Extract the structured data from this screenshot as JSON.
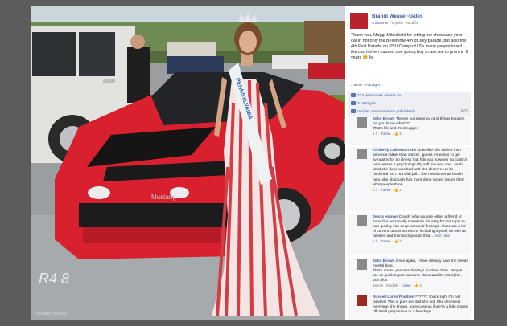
{
  "photo": {
    "credit": "© Image courtesy",
    "plate_text": "R4 8"
  },
  "close": "×",
  "post": {
    "author": "Brandi Weaver-Gates",
    "subscribe": "S'abonner",
    "date": "8 juillet",
    "edited": "Modifié",
    "text": "Thank you, Maggi Mitsubishi for letting me showcase your car in not only the Bellefonte 4th of July parade, but also the 4th Fest Parade on PSU Campus!! So many people loved the car, it even caused one young boy to ask me to prom in 8 years 😊 lol",
    "like": "J'aime",
    "share": "Partager"
  },
  "likes_bar": {
    "text": "213 personnes aiment ça."
  },
  "shares_bar": {
    "text": "3 partages"
  },
  "prev_bar": {
    "text": "Voir les commentaires précédents",
    "count": "6/78"
  },
  "comments": [
    {
      "name": "John Brown",
      "text": "There's no reason a lot of things happen, but you know what???",
      "extra": "That's life and it's struggles",
      "time": "1 h",
      "like": "J'aime",
      "likes": "3"
    },
    {
      "name": "Kimberly Culberson",
      "text": "she looks like she suffers from anorexia rather than cancer.. guess it's easier to get sympathy for an illness that hits you however no control over verses a psychologically self induced one.. yeah what she done was bad and she deserves to be punished BUT not with jail... she needs mental health help. she obviously has more deep rooted issues then what people think",
      "extra": "",
      "time": "1 h",
      "like": "J'aime",
      "likes": "2"
    },
    {
      "name": "Jenna Hoover",
      "text": "Clearly john you are either a friend or know her personally somehow. its easy for this topic to turn quickly into deep personal feelings.. there are a lot of current cancer survivors, including myself, as well as families and friends of people that ...",
      "extra": "Voir plus",
      "time": "1 h",
      "like": "J'aime",
      "likes": "3"
    },
    {
      "name": "John Brown",
      "text": "Once again, I have already said she needs mental help.",
      "extra": "There are no personal feelings involved here. People are so quick to put someone down and it's not right... Voir plus",
      "time": "56 min",
      "edited": "Modifié",
      "like": "J'aime",
      "likes": "4"
    },
    {
      "name": "Russell Loren Positive",
      "text": "?????? You're right I'm not positive! This is pure evil shit she did! She deceived everyone she knows, so excuse us if we're a little pissed off! We'll get positive in a few days",
      "extra": "",
      "time": "",
      "like": "",
      "likes": ""
    }
  ],
  "colors": {
    "fb_blue": "#3b5998",
    "car_red": "#d8202e",
    "overlay": "#5c5c5c"
  }
}
